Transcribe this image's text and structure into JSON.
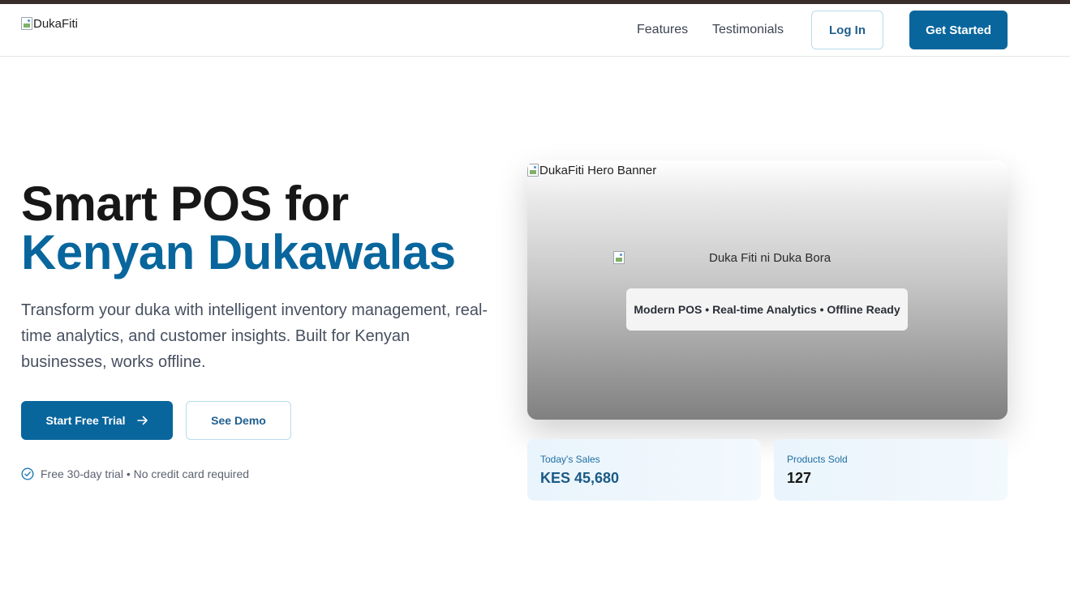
{
  "nav": {
    "logo_alt": "DukaFiti",
    "links": [
      "Features",
      "Testimonials"
    ],
    "login_label": "Log In",
    "get_started_label": "Get Started"
  },
  "hero": {
    "title_line1": "Smart POS for",
    "title_line2": "Kenyan Dukawalas",
    "description": "Transform your duka with intelligent inventory management, real-time analytics, and customer insights. Built for Kenyan businesses, works offline.",
    "primary_button": "Start Free Trial",
    "secondary_button": "See Demo",
    "note": "Free 30-day trial • No credit card required"
  },
  "banner": {
    "image_alt": "DukaFiti Hero Banner",
    "tagline_alt": "Duka Fiti ni Duka Bora",
    "features": "Modern POS • Real-time Analytics • Offline Ready"
  },
  "stats": [
    {
      "label": "Today's Sales",
      "value": "KES 45,680"
    },
    {
      "label": "Products Sold",
      "value": "127"
    }
  ],
  "colors": {
    "brand": "#08669d",
    "top_strip": "#3a2e2c"
  }
}
